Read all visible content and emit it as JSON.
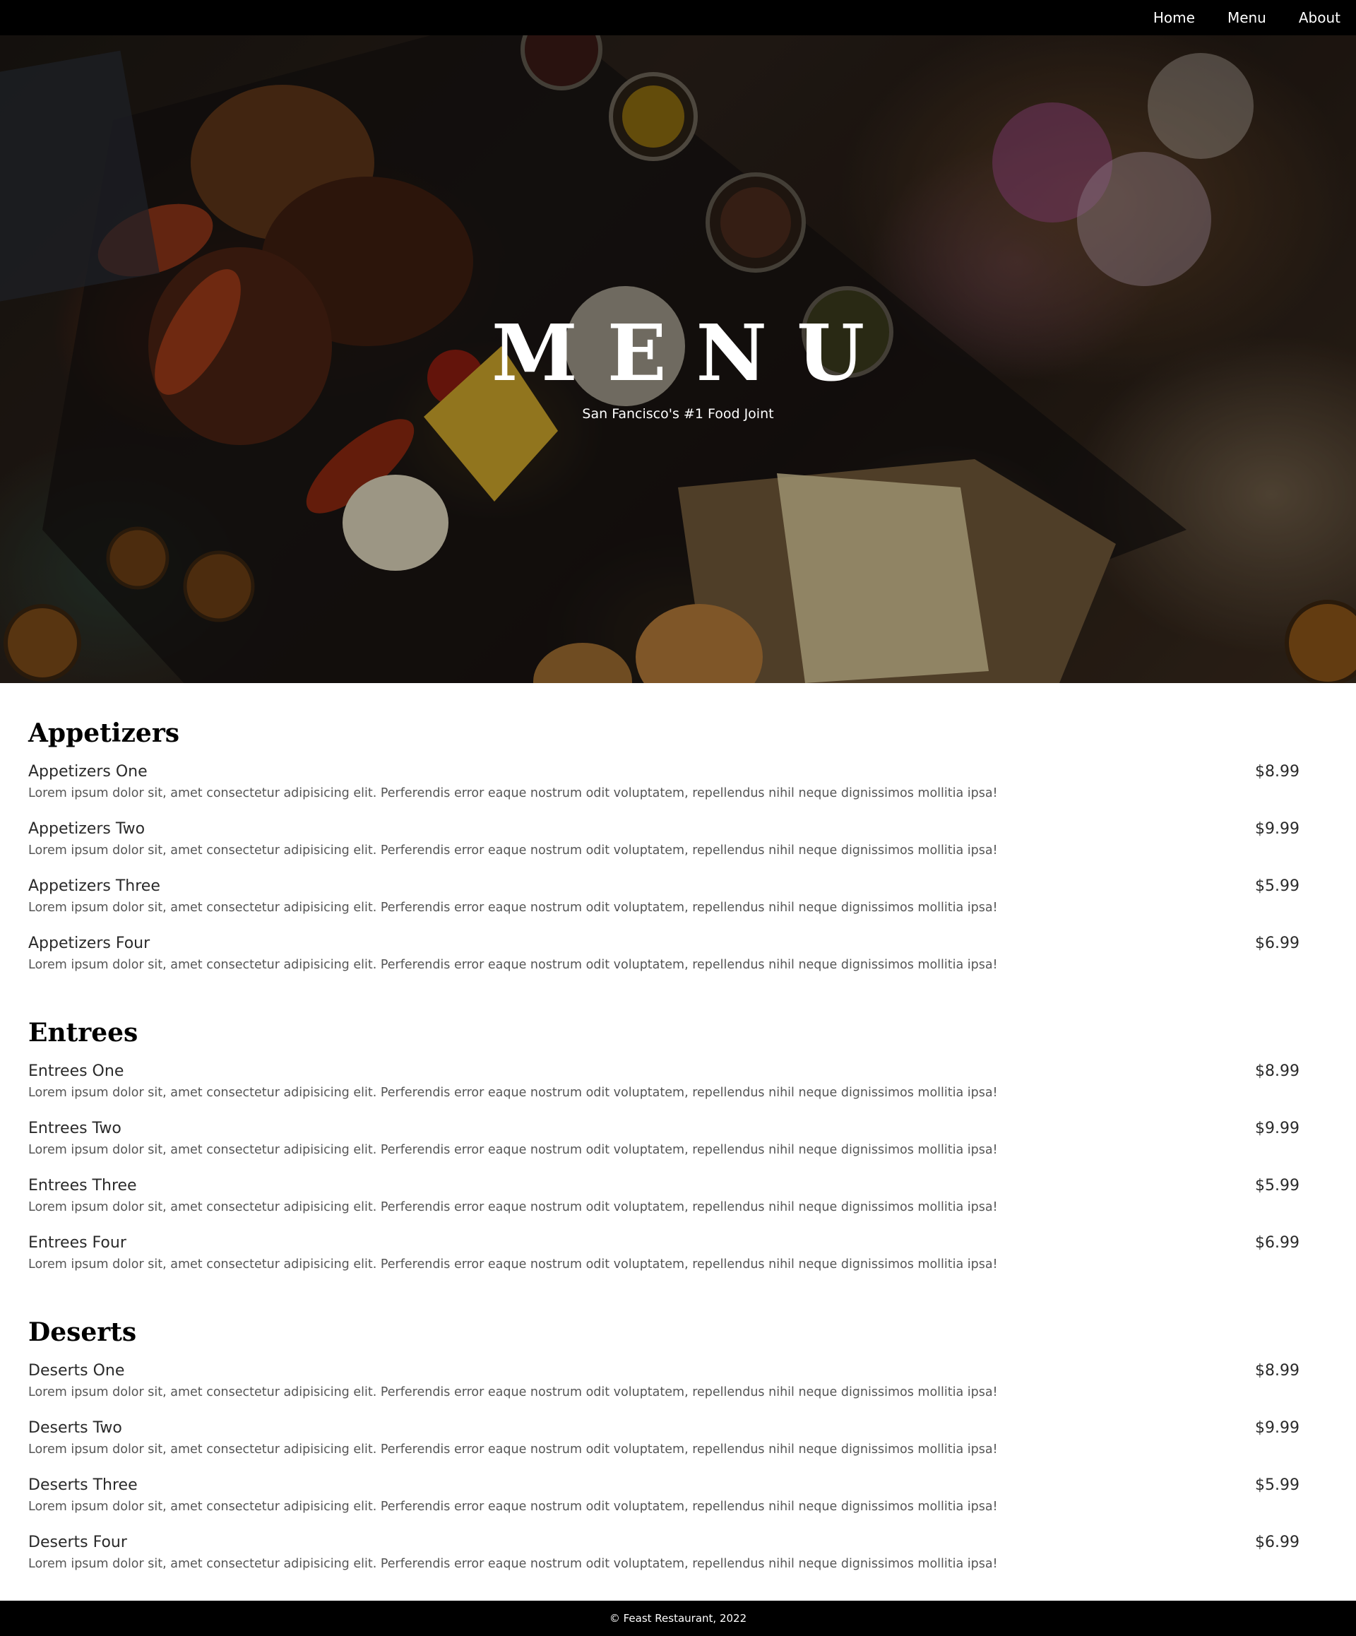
{
  "nav": {
    "links": [
      "Home",
      "Menu",
      "About"
    ]
  },
  "hero": {
    "title": "MENU",
    "subtitle": "San Fancisco's #1 Food Joint"
  },
  "sections": [
    {
      "title": "Appetizers",
      "items": [
        {
          "name": "Appetizers One",
          "price": "$8.99",
          "desc": "Lorem ipsum dolor sit, amet consectetur adipisicing elit. Perferendis error eaque nostrum odit voluptatem, repellendus nihil neque dignissimos mollitia ipsa!"
        },
        {
          "name": "Appetizers Two",
          "price": "$9.99",
          "desc": "Lorem ipsum dolor sit, amet consectetur adipisicing elit. Perferendis error eaque nostrum odit voluptatem, repellendus nihil neque dignissimos mollitia ipsa!"
        },
        {
          "name": "Appetizers Three",
          "price": "$5.99",
          "desc": "Lorem ipsum dolor sit, amet consectetur adipisicing elit. Perferendis error eaque nostrum odit voluptatem, repellendus nihil neque dignissimos mollitia ipsa!"
        },
        {
          "name": "Appetizers Four",
          "price": "$6.99",
          "desc": "Lorem ipsum dolor sit, amet consectetur adipisicing elit. Perferendis error eaque nostrum odit voluptatem, repellendus nihil neque dignissimos mollitia ipsa!"
        }
      ]
    },
    {
      "title": "Entrees",
      "items": [
        {
          "name": "Entrees One",
          "price": "$8.99",
          "desc": "Lorem ipsum dolor sit, amet consectetur adipisicing elit. Perferendis error eaque nostrum odit voluptatem, repellendus nihil neque dignissimos mollitia ipsa!"
        },
        {
          "name": "Entrees Two",
          "price": "$9.99",
          "desc": "Lorem ipsum dolor sit, amet consectetur adipisicing elit. Perferendis error eaque nostrum odit voluptatem, repellendus nihil neque dignissimos mollitia ipsa!"
        },
        {
          "name": "Entrees Three",
          "price": "$5.99",
          "desc": "Lorem ipsum dolor sit, amet consectetur adipisicing elit. Perferendis error eaque nostrum odit voluptatem, repellendus nihil neque dignissimos mollitia ipsa!"
        },
        {
          "name": "Entrees Four",
          "price": "$6.99",
          "desc": "Lorem ipsum dolor sit, amet consectetur adipisicing elit. Perferendis error eaque nostrum odit voluptatem, repellendus nihil neque dignissimos mollitia ipsa!"
        }
      ]
    },
    {
      "title": "Deserts",
      "items": [
        {
          "name": "Deserts One",
          "price": "$8.99",
          "desc": "Lorem ipsum dolor sit, amet consectetur adipisicing elit. Perferendis error eaque nostrum odit voluptatem, repellendus nihil neque dignissimos mollitia ipsa!"
        },
        {
          "name": "Deserts Two",
          "price": "$9.99",
          "desc": "Lorem ipsum dolor sit, amet consectetur adipisicing elit. Perferendis error eaque nostrum odit voluptatem, repellendus nihil neque dignissimos mollitia ipsa!"
        },
        {
          "name": "Deserts Three",
          "price": "$5.99",
          "desc": "Lorem ipsum dolor sit, amet consectetur adipisicing elit. Perferendis error eaque nostrum odit voluptatem, repellendus nihil neque dignissimos mollitia ipsa!"
        },
        {
          "name": "Deserts Four",
          "price": "$6.99",
          "desc": "Lorem ipsum dolor sit, amet consectetur adipisicing elit. Perferendis error eaque nostrum odit voluptatem, repellendus nihil neque dignissimos mollitia ipsa!"
        }
      ]
    }
  ],
  "footer": {
    "text": "© Feast Restaurant, 2022"
  }
}
